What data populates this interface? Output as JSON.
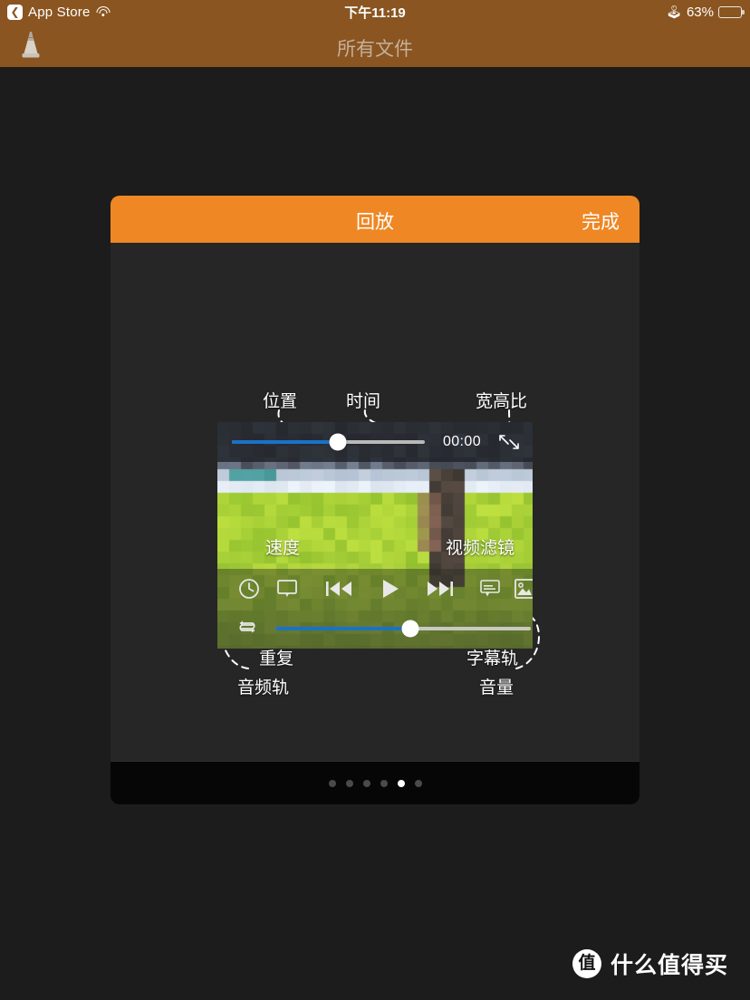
{
  "status_bar": {
    "back_label": "App Store",
    "back_icon": "chevron-left-icon",
    "wifi_icon": "wifi-icon",
    "time": "下午11:19",
    "bluetooth_icon": "bluetooth-icon",
    "battery_percent": "63%",
    "battery_level": 63,
    "background_color": "#8a5520"
  },
  "nav_bar": {
    "app_icon": "vlc-cone-icon",
    "title": "所有文件",
    "background_color": "#8a5520",
    "title_color": "#c5b09b"
  },
  "card": {
    "header": {
      "title": "回放",
      "done_label": "完成",
      "background_color": "#ef8724"
    },
    "footer": {
      "page_dots_total": 6,
      "page_dots_active_index": 4
    }
  },
  "player": {
    "time_display": "00:00",
    "position_slider": {
      "value_percent": 55,
      "fill_color": "#1a72c8"
    },
    "volume_slider": {
      "value_percent": 53,
      "fill_color": "#1a72c8"
    },
    "aspect_icon": "aspect-ratio-arrows-icon",
    "controls": [
      {
        "name": "speed-clock-icon",
        "label": "速度"
      },
      {
        "name": "audio-track-screen-icon",
        "label": "音频轨"
      },
      {
        "name": "previous-track-icon",
        "label": "上一个"
      },
      {
        "name": "play-icon",
        "label": "播放"
      },
      {
        "name": "next-track-icon",
        "label": "下一个"
      },
      {
        "name": "subtitle-track-icon",
        "label": "字幕轨"
      },
      {
        "name": "video-filter-image-icon",
        "label": "视频滤镜"
      }
    ],
    "repeat_icon": "repeat-loop-icon"
  },
  "annotations": {
    "position": "位置",
    "time": "时间",
    "aspect_ratio": "宽高比",
    "speed": "速度",
    "video_filter": "视频滤镜",
    "repeat": "重复",
    "audio_track": "音频轨",
    "subtitle_track": "字幕轨",
    "volume": "音量"
  },
  "watermark": {
    "badge": "值",
    "text": "什么值得买"
  }
}
